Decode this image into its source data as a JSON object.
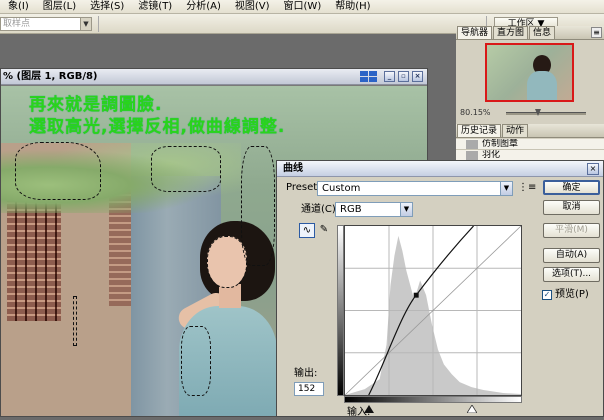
{
  "menubar": {
    "items": [
      "象(I)",
      "图层(L)",
      "选择(S)",
      "滤镜(T)",
      "分析(A)",
      "视图(V)",
      "窗口(W)",
      "帮助(H)"
    ]
  },
  "options": {
    "preset_placeholder": "取样点",
    "workspace": "工作区 ▼"
  },
  "document": {
    "title": "% (图层 1, RGB/8)"
  },
  "caption": {
    "line1": "再來就是調圖臉.",
    "line2": "選取高光,選擇反相,做曲線調整."
  },
  "navigator": {
    "tabs": [
      "导航器",
      "直方图",
      "信息"
    ],
    "zoom": "80.15%"
  },
  "history": {
    "tabs": [
      "历史记录",
      "动作"
    ],
    "items": [
      "仿制图章",
      "羽化"
    ]
  },
  "curves": {
    "title": "曲线",
    "preset_label": "Preset:",
    "preset_value": "Custom",
    "channel_label": "通道(C):",
    "channel_value": "RGB",
    "output_label": "输出:",
    "output_value": "152",
    "input_label": "输入:",
    "buttons": {
      "ok": "确定",
      "cancel": "取消",
      "smooth": "平滑(M)",
      "auto": "自动(A)",
      "options": "选项(T)...",
      "preview": "预览(P)"
    },
    "preview_checked": true
  },
  "colors": {
    "caption": "#2ad41b",
    "nav_frame": "#d91818",
    "curve": "#111111"
  }
}
